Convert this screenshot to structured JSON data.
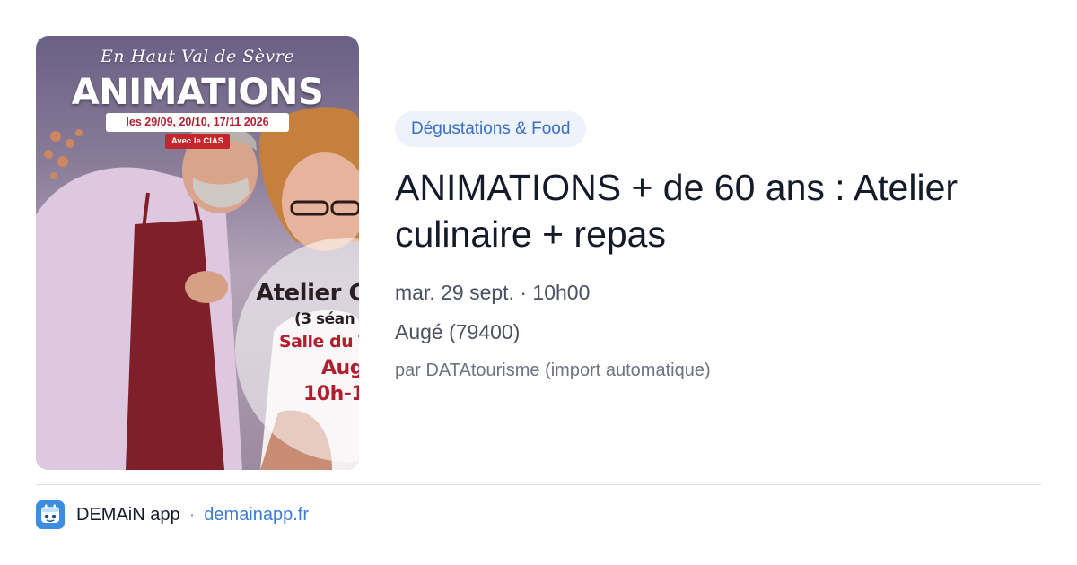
{
  "poster": {
    "tagline": "En Haut Val de Sèvre",
    "headline": "ANIMATIONS",
    "dates": "les 29/09, 20/10, 17/11 2026",
    "partner": "Avec le CIAS",
    "line1": "Atelier Cu",
    "line2": "(3 séan",
    "line3": "Salle du T",
    "line4": "Auge",
    "line5": "10h-1"
  },
  "event": {
    "category": "Dégustations & Food",
    "title": "ANIMATIONS + de 60 ans : Atelier culinaire + repas",
    "datetime": "mar. 29 sept. · 10h00",
    "location": "Augé (79400)",
    "source": "par DATAtourisme (import automatique)"
  },
  "footer": {
    "app_name": "DEMAiN app",
    "separator": "·",
    "domain": "demainapp.fr",
    "icon": "demain-app-icon"
  },
  "colors": {
    "category_bg": "#edf2fb",
    "category_text": "#3a6fc3",
    "title": "#131a2a",
    "link": "#3c7bd6",
    "app_icon": "#3c8ce0"
  }
}
